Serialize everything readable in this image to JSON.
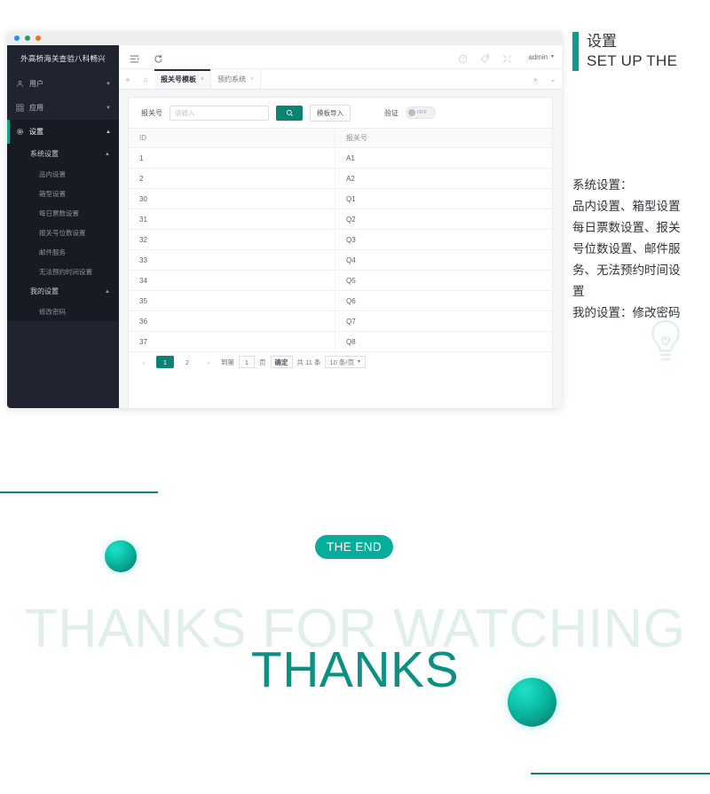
{
  "window": {
    "chrome_dots": [
      "blue",
      "green",
      "orange"
    ],
    "sidebar": {
      "brand": "外高桥海关查验八科畅兴",
      "items": [
        {
          "label": "用户",
          "icon": "user-icon",
          "arrow": "▼",
          "active": false
        },
        {
          "label": "应用",
          "icon": "apps-icon",
          "arrow": "▼",
          "active": false
        },
        {
          "label": "设置",
          "icon": "gear-icon",
          "arrow": "▲",
          "active": true
        }
      ],
      "groups": [
        {
          "label": "系统设置",
          "arrow": "▲",
          "children": [
            "品内设置",
            "箱型设置",
            "每日票数设置",
            "报关号位数设置",
            "邮件服务",
            "无法预约时间设置"
          ]
        },
        {
          "label": "我的设置",
          "arrow": "▲",
          "children": [
            "修改密码"
          ]
        }
      ]
    },
    "topbar": {
      "collapse_icon": "menu-collapse-icon",
      "refresh_icon": "refresh-icon",
      "right_icons": [
        "dashboard-icon",
        "tag-icon",
        "fullscreen-icon"
      ],
      "admin_label": "admin",
      "admin_caret": "▼"
    },
    "tabbar": {
      "prev_icon": "«",
      "home_icon": "⌂",
      "tabs": [
        {
          "label": "报关号模板",
          "close": "×",
          "active": true
        },
        {
          "label": "预约系统",
          "close": "×",
          "active": false
        }
      ],
      "next_icon": "»",
      "more_icon": "⌄"
    },
    "filter": {
      "field_label": "报关号",
      "input_value": "",
      "input_placeholder": "请输入",
      "search_icon": "search-icon",
      "import_button": "模板导入",
      "verify_label": "验证",
      "toggle_state": "OFF"
    },
    "table": {
      "columns": [
        "ID",
        "报关号"
      ],
      "rows": [
        [
          "1",
          "A1"
        ],
        [
          "2",
          "A2"
        ],
        [
          "30",
          "Q1"
        ],
        [
          "31",
          "Q2"
        ],
        [
          "32",
          "Q3"
        ],
        [
          "33",
          "Q4"
        ],
        [
          "34",
          "Q5"
        ],
        [
          "35",
          "Q6"
        ],
        [
          "36",
          "Q7"
        ],
        [
          "37",
          "Q8"
        ]
      ]
    },
    "pagination": {
      "prev": "‹",
      "pages": [
        "1",
        "2"
      ],
      "current_page": "1",
      "next": "›",
      "goto_label": "到第",
      "goto_value": "1",
      "page_unit": "页",
      "confirm": "确定",
      "total_text": "共 11 条",
      "page_size": "10 条/页",
      "page_size_caret": "▼"
    }
  },
  "right_panel": {
    "title_cn": "设置",
    "title_en": "SET UP THE",
    "accent_color": "#0d9c8a",
    "body_lines": [
      "系统设置：",
      "品内设置、箱型设置",
      "每日票数设置、报关",
      "号位数设置、邮件服",
      "务、无法预约时间设",
      "置",
      "我的设置：修改密码"
    ],
    "watermark_icon": "lightbulb-icon"
  },
  "footer": {
    "pill_label": "THE END",
    "ghost_text": "THANKS FOR WATCHING",
    "main_text": "THANKS",
    "accent_color": "#0b8274",
    "sphere_color": "#0ec7ae"
  }
}
